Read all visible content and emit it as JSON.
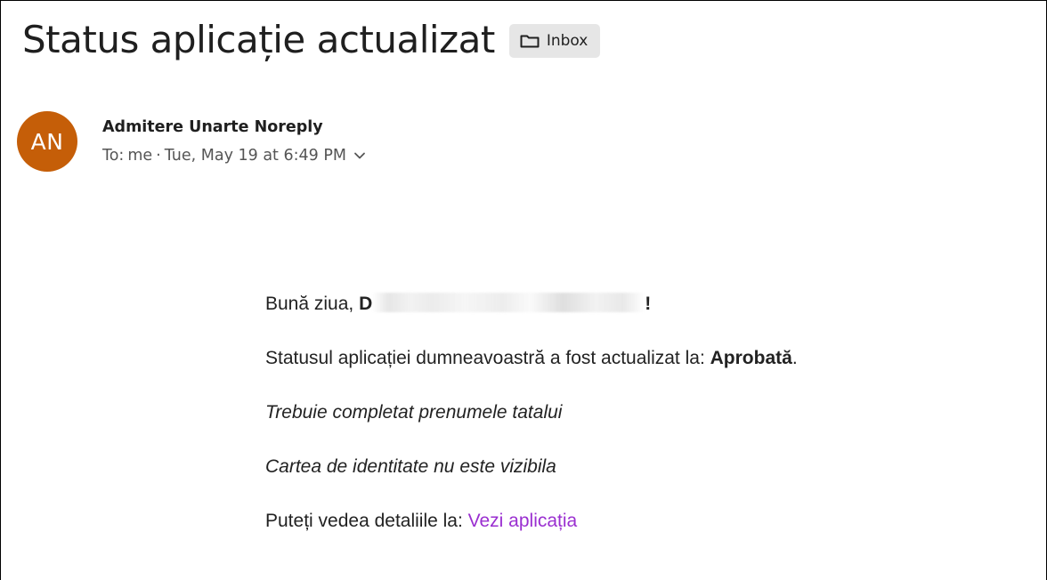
{
  "email": {
    "subject": "Status aplicație actualizat",
    "folder": {
      "label": "Inbox",
      "icon": "folder-icon"
    },
    "sender": {
      "avatar_initials": "AN",
      "avatar_color": "#c55e08",
      "name": "Admitere Unarte Noreply",
      "to_prefix": "To:",
      "to": "me",
      "separator": "·",
      "date": "Tue, May 19 at 6:49 PM",
      "expand_icon": "chevron-down-icon"
    },
    "body": {
      "greeting_prefix": "Bună ziua, ",
      "greeting_name_initial": "D",
      "greeting_suffix": "!",
      "status_text": "Statusul aplicației dumneavoastră a fost actualizat la: ",
      "status_value": "Aprobată",
      "status_end": ".",
      "note_1": "Trebuie completat prenumele tatalui",
      "note_2": "Cartea de identitate nu este vizibila",
      "details_prefix": "Puteți vedea detaliile la: ",
      "details_link": "Vezi aplicația",
      "link_color": "#9a2fd0"
    }
  }
}
